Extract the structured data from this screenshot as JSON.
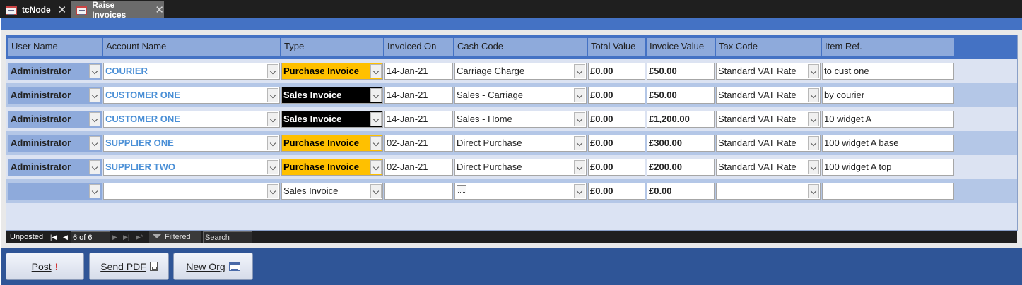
{
  "tabs": [
    {
      "label": "tcNode"
    },
    {
      "label": "Raise Invoices"
    }
  ],
  "columns": [
    "User Name",
    "Account Name",
    "Type",
    "Invoiced On",
    "Cash Code",
    "Total Value",
    "Invoice Value",
    "Tax Code",
    "Item Ref."
  ],
  "rows": [
    {
      "user": "Administrator",
      "account": "COURIER",
      "type": "Purchase Invoice",
      "type_style": "purchase",
      "invoiced_on": "14-Jan-21",
      "cash_code": "Carriage Charge",
      "total_value": "£0.00",
      "invoice_value": "£50.00",
      "tax_code": "Standard VAT Rate",
      "item_ref": "to cust one"
    },
    {
      "user": "Administrator",
      "account": "CUSTOMER ONE",
      "type": "Sales Invoice",
      "type_style": "sales",
      "invoiced_on": "14-Jan-21",
      "cash_code": "Sales - Carriage",
      "total_value": "£0.00",
      "invoice_value": "£50.00",
      "tax_code": "Standard VAT Rate",
      "item_ref": "by courier"
    },
    {
      "user": "Administrator",
      "account": "CUSTOMER ONE",
      "type": "Sales Invoice",
      "type_style": "sales",
      "invoiced_on": "14-Jan-21",
      "cash_code": "Sales - Home",
      "total_value": "£0.00",
      "invoice_value": "£1,200.00",
      "tax_code": "Standard VAT Rate",
      "item_ref": "10 widget A"
    },
    {
      "user": "Administrator",
      "account": "SUPPLIER ONE",
      "type": "Purchase Invoice",
      "type_style": "purchase",
      "invoiced_on": "02-Jan-21",
      "cash_code": "Direct Purchase",
      "total_value": "£0.00",
      "invoice_value": "£300.00",
      "tax_code": "Standard VAT Rate",
      "item_ref": "100 widget A base"
    },
    {
      "user": "Administrator",
      "account": "SUPPLIER TWO",
      "type": "Purchase Invoice",
      "type_style": "purchase",
      "invoiced_on": "02-Jan-21",
      "cash_code": "Direct Purchase",
      "total_value": "£0.00",
      "invoice_value": "£200.00",
      "tax_code": "Standard VAT Rate",
      "item_ref": "100 widget A top"
    },
    {
      "user": "",
      "account": "",
      "type": "Sales Invoice",
      "type_style": "new",
      "invoiced_on": "",
      "cash_code": "",
      "total_value": "£0.00",
      "invoice_value": "£0.00",
      "tax_code": "",
      "item_ref": ""
    }
  ],
  "nav": {
    "filter_name": "Unposted",
    "record": "6 of 6",
    "filter_status": "Filtered",
    "search": "Search"
  },
  "buttons": {
    "post": "Post",
    "send_pdf": "Send PDF",
    "new_org": "New Org"
  },
  "colors": {
    "header_band": "#4472c4",
    "purchase_type": "#ffc000",
    "sales_type": "#000000",
    "footer": "#2f5597"
  }
}
